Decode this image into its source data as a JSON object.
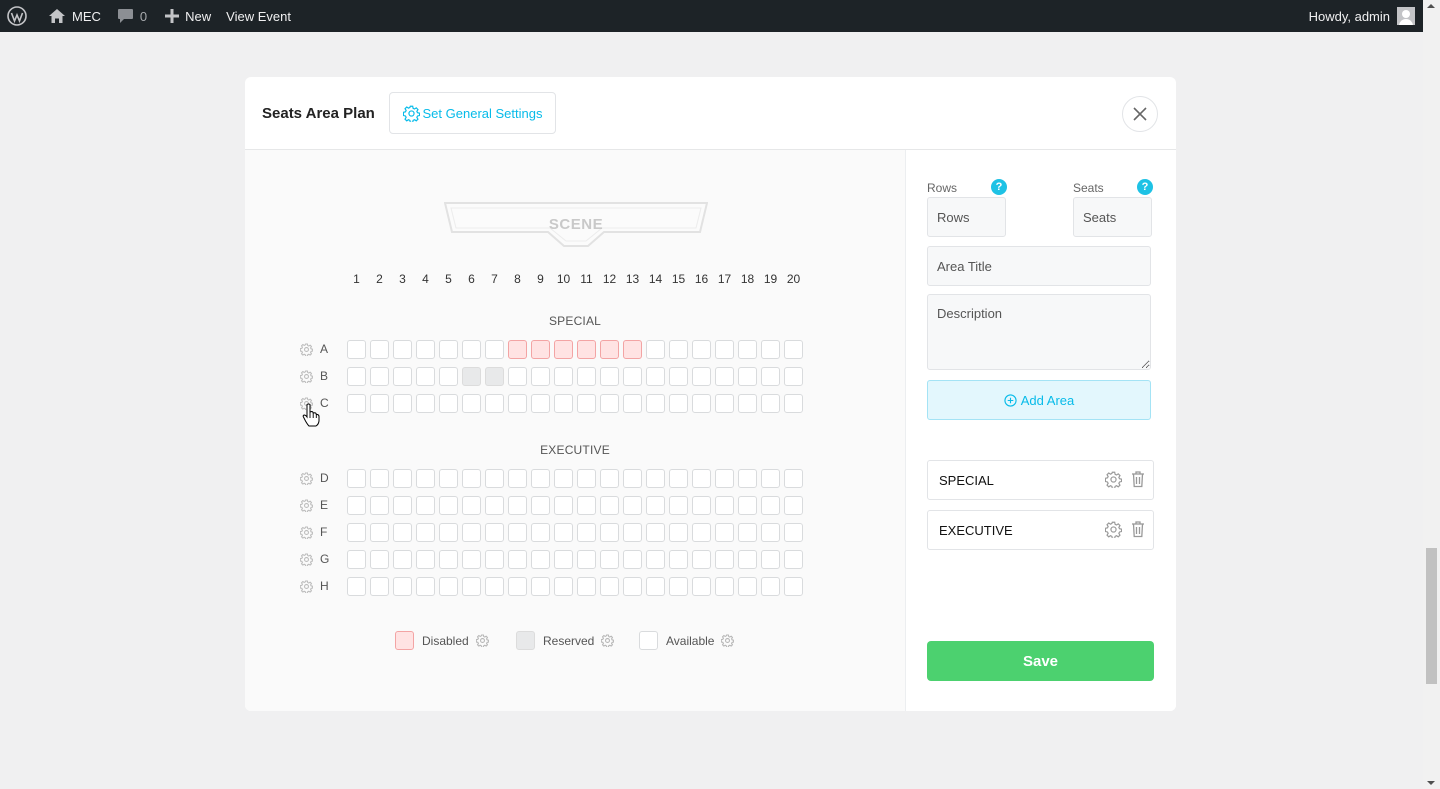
{
  "adminbar": {
    "site_name": "MEC",
    "comments_count": "0",
    "new_label": "New",
    "view_event_label": "View Event",
    "howdy_label": "Howdy, admin"
  },
  "modal": {
    "title": "Seats Area Plan",
    "general_settings_label": "Set General Settings",
    "scene_label": "SCENE",
    "columns": [
      "1",
      "2",
      "3",
      "4",
      "5",
      "6",
      "7",
      "8",
      "9",
      "10",
      "11",
      "12",
      "13",
      "14",
      "15",
      "16",
      "17",
      "18",
      "19",
      "20"
    ],
    "areas": [
      {
        "name": "SPECIAL",
        "rows": [
          {
            "letter": "A",
            "disabled_seats": [
              8,
              9,
              10,
              11,
              12,
              13
            ],
            "reserved_seats": []
          },
          {
            "letter": "B",
            "disabled_seats": [],
            "reserved_seats": [
              6,
              7
            ]
          },
          {
            "letter": "C",
            "disabled_seats": [],
            "reserved_seats": []
          }
        ]
      },
      {
        "name": "EXECUTIVE",
        "rows": [
          {
            "letter": "D",
            "disabled_seats": [],
            "reserved_seats": []
          },
          {
            "letter": "E",
            "disabled_seats": [],
            "reserved_seats": []
          },
          {
            "letter": "F",
            "disabled_seats": [],
            "reserved_seats": []
          },
          {
            "letter": "G",
            "disabled_seats": [],
            "reserved_seats": []
          },
          {
            "letter": "H",
            "disabled_seats": [],
            "reserved_seats": []
          }
        ]
      }
    ],
    "legend": {
      "disabled": "Disabled",
      "reserved": "Reserved",
      "available": "Available"
    },
    "form": {
      "rows_label": "Rows",
      "rows_placeholder": "Rows",
      "seats_label": "Seats",
      "seats_placeholder": "Seats",
      "help_glyph": "?",
      "area_title_placeholder": "Area Title",
      "description_placeholder": "Description",
      "add_area_label": "Add Area"
    },
    "area_list": [
      "SPECIAL",
      "EXECUTIVE"
    ],
    "save_label": "Save"
  },
  "colors": {
    "accent": "#07bbe9",
    "save_green": "#4cd16f",
    "disabled_fill": "#ffe3e3",
    "disabled_border": "#f3a4a4",
    "reserved_fill": "#e8e9ea"
  },
  "icons": [
    "wordpress-icon",
    "home-icon",
    "comment-icon",
    "plus-icon",
    "avatar-icon",
    "gear-icon",
    "close-icon",
    "plus-circle-icon",
    "trash-icon",
    "hand-cursor-icon"
  ]
}
